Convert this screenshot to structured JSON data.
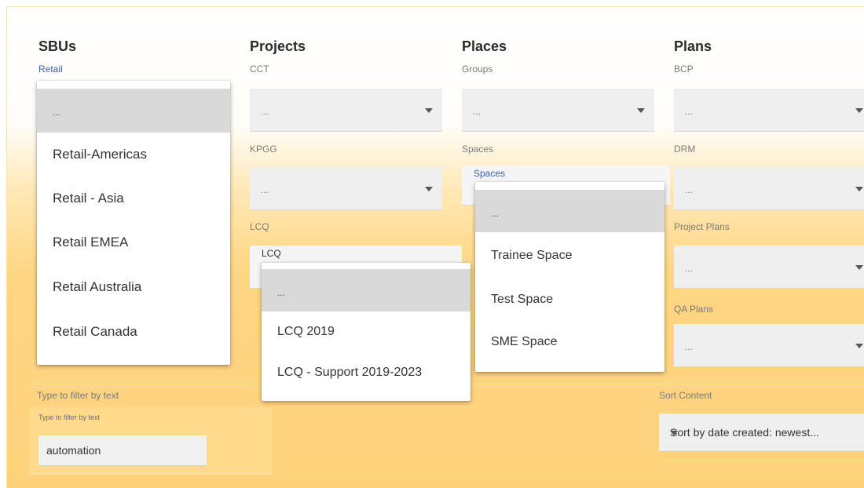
{
  "sbus": {
    "title": "SBUs",
    "label": "Retail",
    "dropdown": {
      "empty_option": "...",
      "options": [
        "Retail-Americas",
        "Retail - Asia",
        "Retail EMEA",
        "Retail Australia",
        "Retail Canada"
      ]
    }
  },
  "projects": {
    "title": "Projects",
    "cct": {
      "label": "CCT",
      "value": "..."
    },
    "kpgg": {
      "label": "KPGG",
      "value": "..."
    },
    "lcq": {
      "label": "LCQ",
      "floating_label": "LCQ",
      "dropdown": {
        "empty_option": "...",
        "options": [
          "LCQ 2019",
          "LCQ - Support 2019-2023"
        ]
      }
    }
  },
  "places": {
    "title": "Places",
    "groups": {
      "label": "Groups",
      "value": "..."
    },
    "spaces": {
      "label": "Spaces",
      "floating_label": "Spaces",
      "dropdown": {
        "empty_option": "...",
        "options": [
          "Trainee Space",
          "Test Space",
          "SME Space"
        ]
      }
    }
  },
  "plans": {
    "title": "Plans",
    "bcp": {
      "label": "BCP",
      "value": "..."
    },
    "drm": {
      "label": "DRM",
      "value": "..."
    },
    "project_plans": {
      "label": "Project Plans",
      "value": "..."
    },
    "qa_plans": {
      "label": "QA Plans",
      "value": "..."
    }
  },
  "filter": {
    "label": "Type to filter by text",
    "floating_label": "Type to filter by text",
    "value": "automation"
  },
  "sort": {
    "label": "Sort Content",
    "value": "Sort by date created: newest..."
  }
}
